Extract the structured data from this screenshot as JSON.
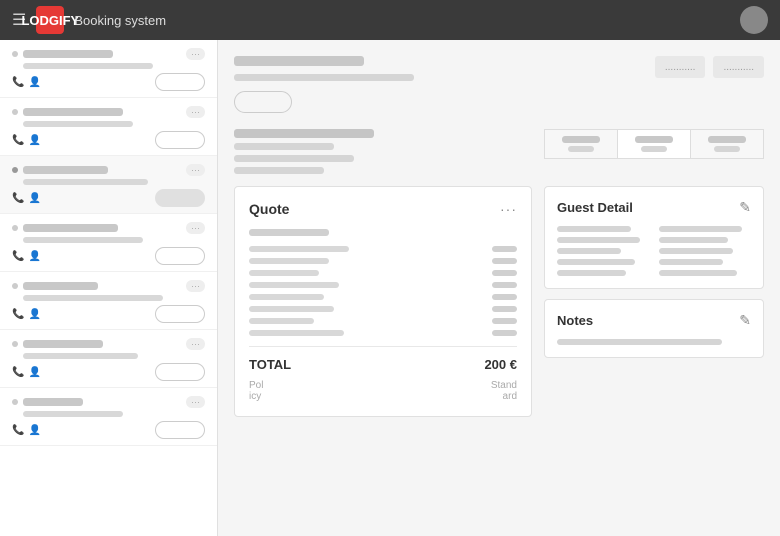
{
  "app": {
    "name": "LODGIFY",
    "system": "Booking system"
  },
  "topnav": {
    "hamburger": "☰",
    "logo_text": "L",
    "title": "Booking system"
  },
  "sidebar": {
    "items": [
      {
        "badge": "...",
        "btn_filled": false
      },
      {
        "badge": "...",
        "btn_filled": false
      },
      {
        "badge": "...",
        "btn_filled": true
      },
      {
        "badge": "...",
        "btn_filled": false
      },
      {
        "badge": "...",
        "btn_filled": false
      },
      {
        "badge": "...",
        "btn_filled": false
      },
      {
        "badge": "...",
        "btn_filled": false
      }
    ]
  },
  "main": {
    "header_btn": "",
    "right_btn1": "...........",
    "right_btn2": "...........",
    "tabs": [
      {
        "line1": "",
        "line2": ""
      },
      {
        "line1": "",
        "line2": ""
      },
      {
        "line1": "",
        "line2": ""
      }
    ],
    "quote": {
      "title": "Quote",
      "menu": "···",
      "total_label": "TOTAL",
      "total_value": "200 €",
      "footer_left1": "Pol",
      "footer_left2": "icy",
      "footer_right1": "Stand",
      "footer_right2": "ard"
    },
    "guest_detail": {
      "title": "Guest Detail",
      "edit_icon": "✎"
    },
    "notes": {
      "title": "Notes",
      "edit_icon": "✎"
    }
  }
}
